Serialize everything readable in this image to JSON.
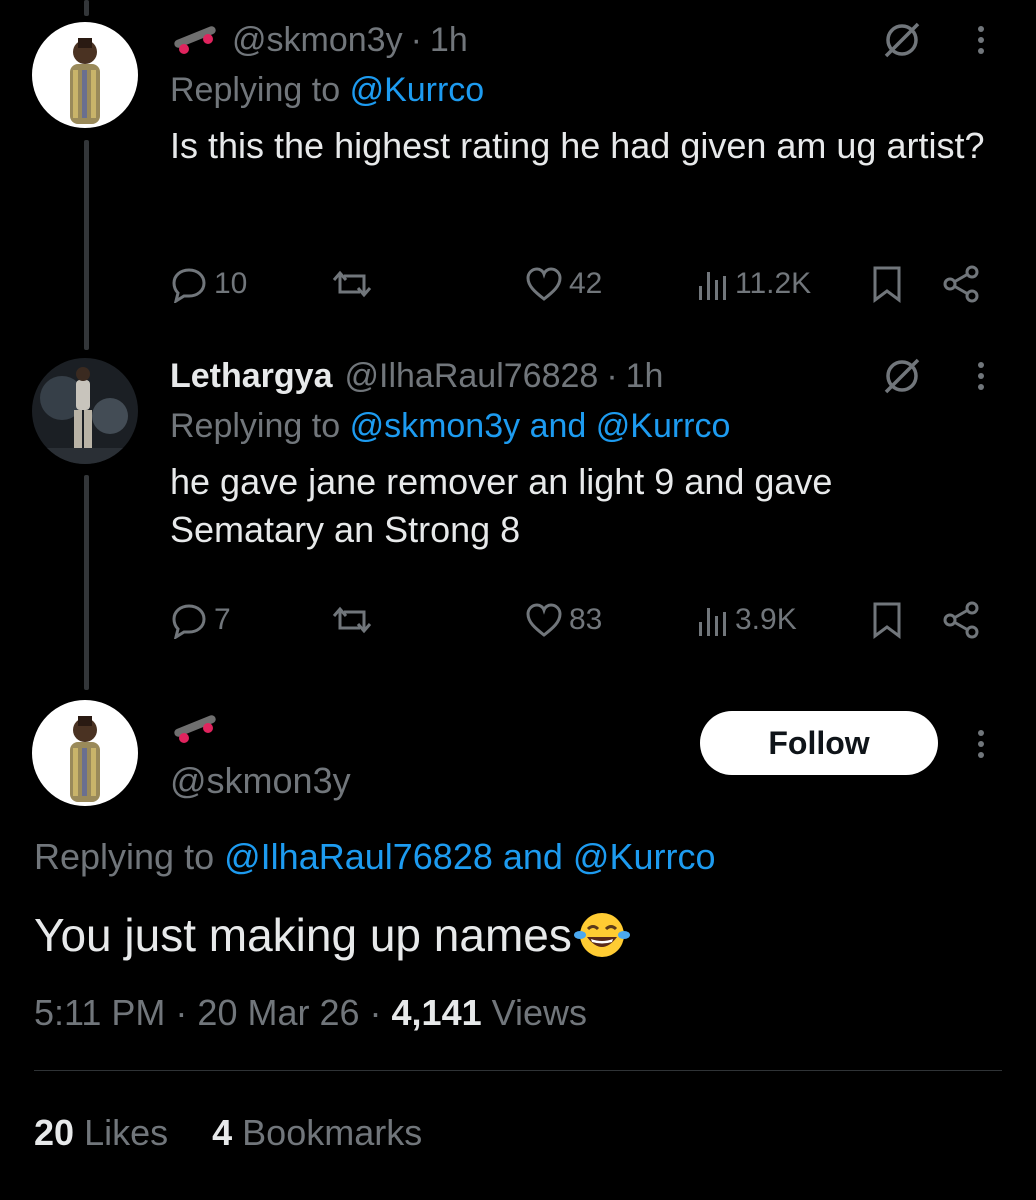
{
  "tweet1": {
    "handle": "@skmon3y",
    "time": "1h",
    "replying_prefix": "Replying to",
    "replying_to": "@Kurrco",
    "text": "Is this the highest rating he had given am ug artist?",
    "replies": "10",
    "likes": "42",
    "views": "11.2K",
    "emoji_icon": "skateboard-icon"
  },
  "tweet2": {
    "name": "Lethargya",
    "handle": "@IlhaRaul76828",
    "time": "1h",
    "replying_prefix": "Replying to",
    "replying_to": "@skmon3y and @Kurrco",
    "text": "he gave jane remover an light 9 and gave Sematary an Strong 8",
    "replies": "7",
    "likes": "83",
    "views": "3.9K"
  },
  "main": {
    "handle": "@skmon3y",
    "follow_label": "Follow",
    "replying_prefix": "Replying to",
    "replying_to": "@IlhaRaul76828 and @Kurrco",
    "text": "You just making up names",
    "emoji_icon": "face-with-tears-of-joy-icon",
    "time": "5:11 PM",
    "date": "20 Mar 26",
    "views_count": "4,141",
    "views_label": "Views",
    "likes_count": "20",
    "likes_label": "Likes",
    "bookmarks_count": "4",
    "bookmarks_label": "Bookmarks"
  },
  "colors": {
    "background": "#000000",
    "text": "#e7e9ea",
    "muted": "#71767b",
    "link": "#1d9bf0"
  }
}
